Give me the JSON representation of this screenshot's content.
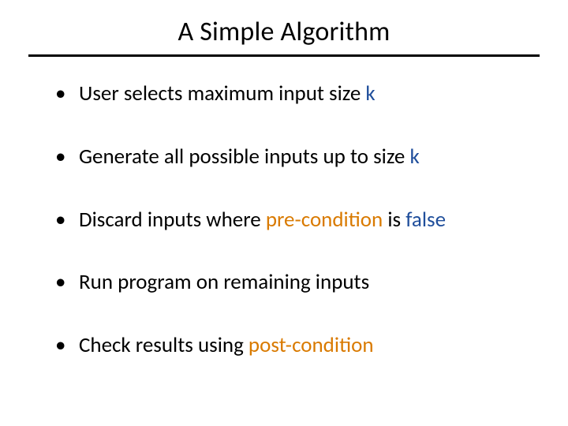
{
  "title": "A Simple Algorithm",
  "bullets": [
    {
      "pre": "User selects maximum input size ",
      "accent": "k",
      "accentClass": "accent-blue",
      "post": ""
    },
    {
      "pre": "Generate all possible inputs up to size ",
      "accent": "k",
      "accentClass": "accent-blue",
      "post": ""
    },
    {
      "pre": "Discard inputs where ",
      "accent": "pre-condition",
      "accentClass": "accent-orange",
      "post": " is ",
      "accent2": "false",
      "accent2Class": "accent-blue"
    },
    {
      "pre": "Run program on remaining inputs",
      "accent": "",
      "accentClass": "",
      "post": ""
    },
    {
      "pre": "Check results using ",
      "accent": "post-condition",
      "accentClass": "accent-orange",
      "post": ""
    }
  ]
}
